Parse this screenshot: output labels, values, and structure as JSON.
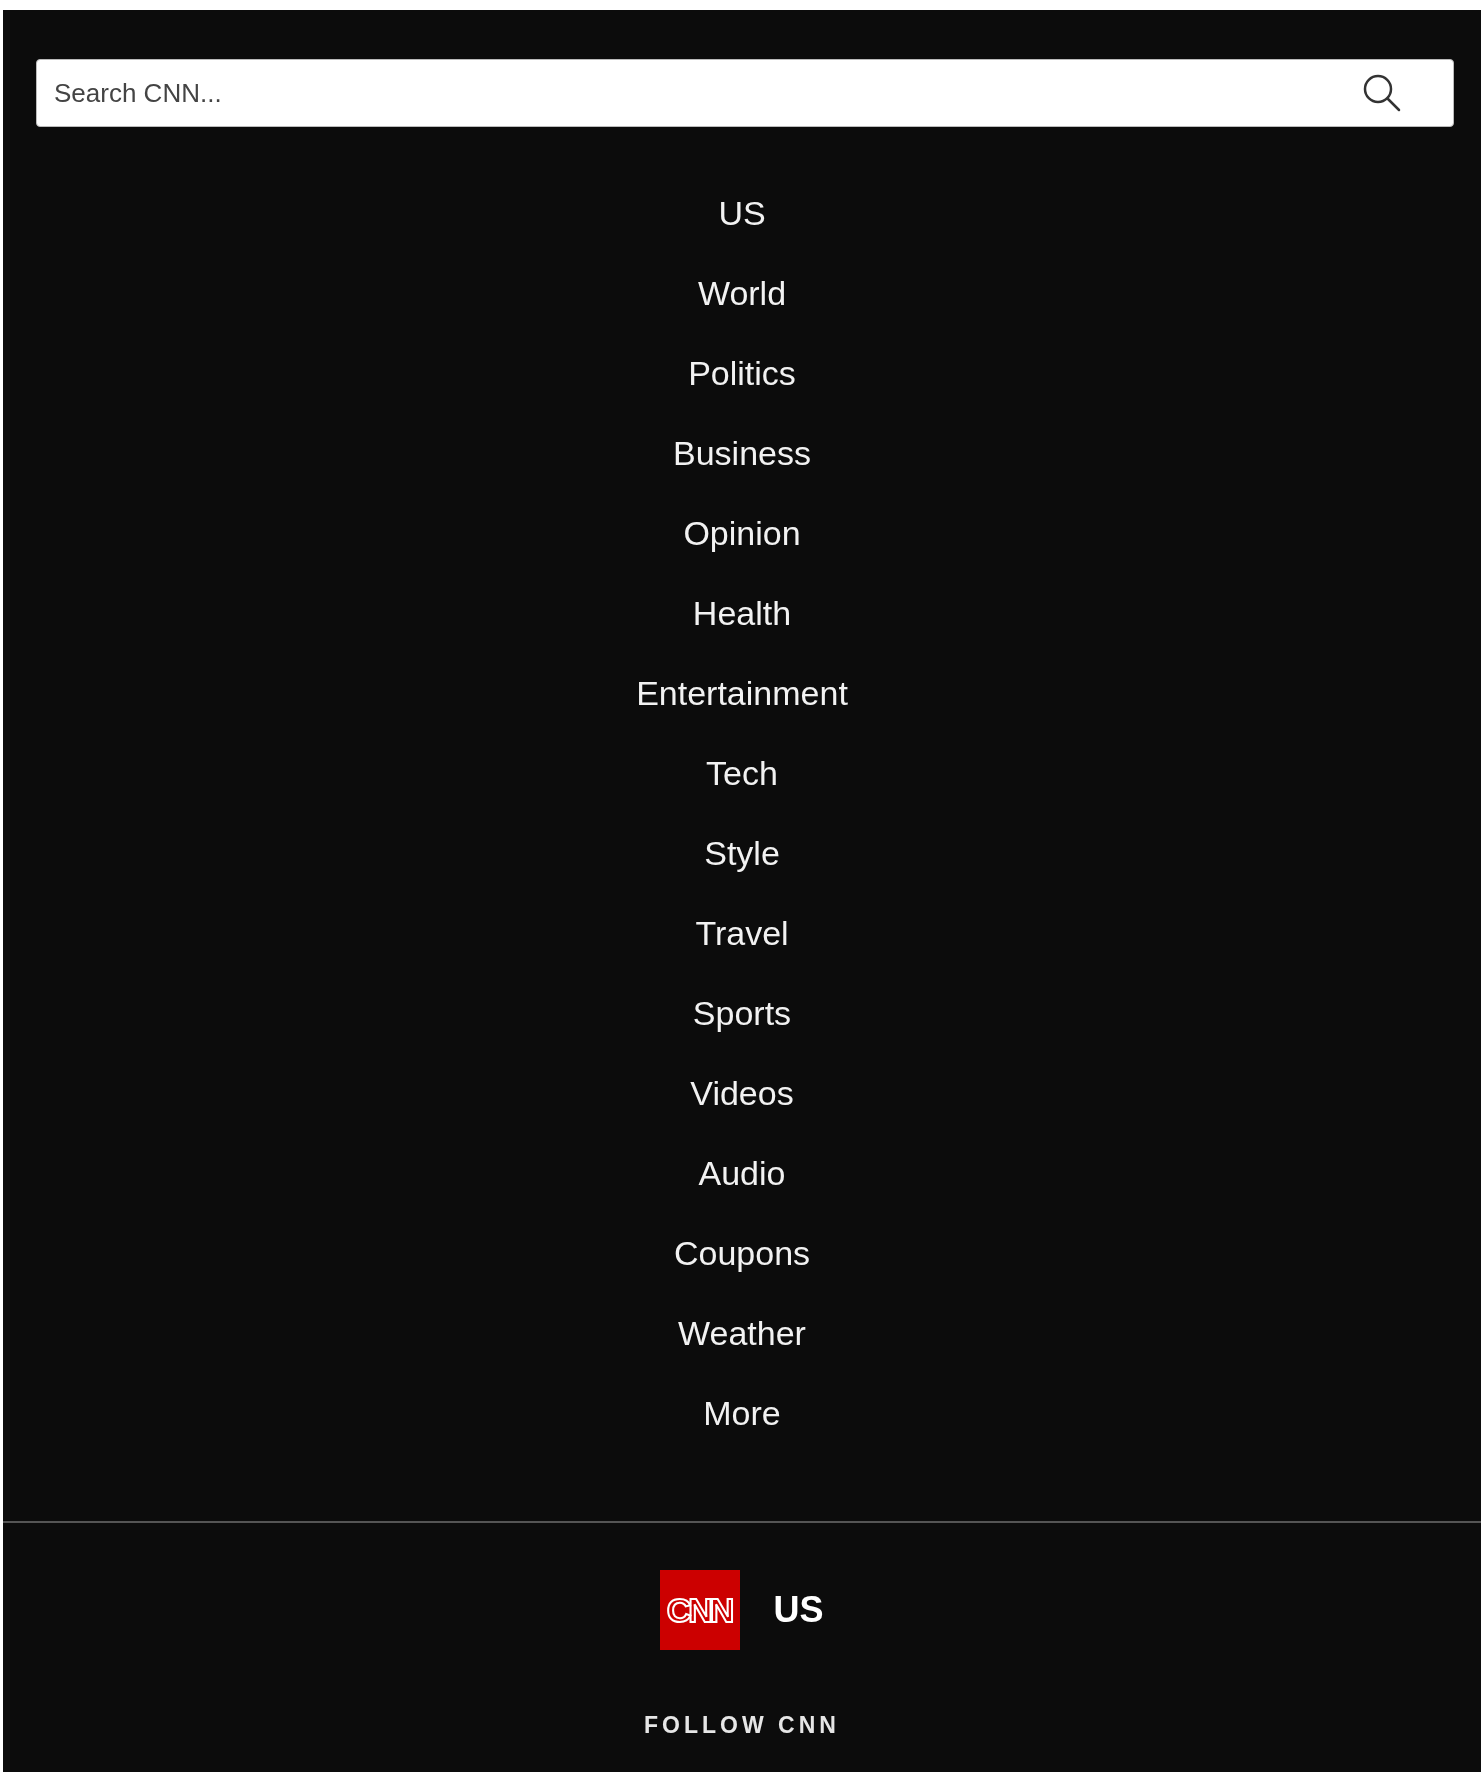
{
  "search": {
    "placeholder": "Search CNN..."
  },
  "nav": [
    "US",
    "World",
    "Politics",
    "Business",
    "Opinion",
    "Health",
    "Entertainment",
    "Tech",
    "Style",
    "Travel",
    "Sports",
    "Videos",
    "Audio",
    "Coupons",
    "Weather",
    "More"
  ],
  "footer": {
    "logo": "CNN",
    "edition": "US",
    "follow_heading": "FOLLOW CNN"
  }
}
